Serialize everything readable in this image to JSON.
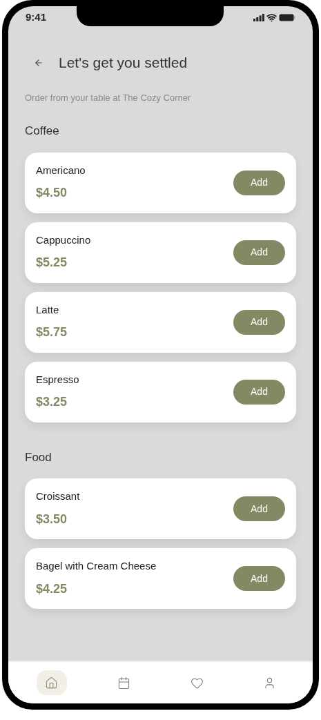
{
  "status_bar": {
    "time": "9:41"
  },
  "header": {
    "title": "Let's get you settled",
    "subtitle": "Order from your table at The Cozy Corner"
  },
  "sections": [
    {
      "title": "Coffee",
      "items": [
        {
          "name": "Americano",
          "price": "$4.50",
          "button": "Add"
        },
        {
          "name": "Cappuccino",
          "price": "$5.25",
          "button": "Add"
        },
        {
          "name": "Latte",
          "price": "$5.75",
          "button": "Add"
        },
        {
          "name": "Espresso",
          "price": "$3.25",
          "button": "Add"
        }
      ]
    },
    {
      "title": "Food",
      "items": [
        {
          "name": "Croissant",
          "price": "$3.50",
          "button": "Add"
        },
        {
          "name": "Bagel with Cream Cheese",
          "price": "$4.25",
          "button": "Add"
        }
      ]
    }
  ],
  "bottom_nav": [
    {
      "kind": "home",
      "selected": true
    },
    {
      "kind": "calendar",
      "selected": false
    },
    {
      "kind": "favorites",
      "selected": false
    },
    {
      "kind": "profile",
      "selected": false
    }
  ]
}
